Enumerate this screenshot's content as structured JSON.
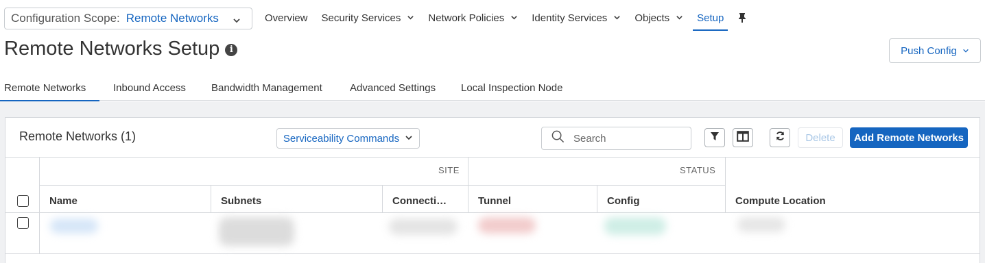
{
  "scope": {
    "label": "Configuration Scope:",
    "value": "Remote Networks"
  },
  "nav": {
    "items": [
      {
        "label": "Overview",
        "dropdown": false
      },
      {
        "label": "Security Services",
        "dropdown": true
      },
      {
        "label": "Network Policies",
        "dropdown": true
      },
      {
        "label": "Identity Services",
        "dropdown": true
      },
      {
        "label": "Objects",
        "dropdown": true
      },
      {
        "label": "Setup",
        "dropdown": false,
        "active": true
      }
    ],
    "pin_icon": "pin-icon"
  },
  "page": {
    "title": "Remote Networks Setup",
    "info_glyph": "i"
  },
  "push_config": {
    "label": "Push Config"
  },
  "tabs": [
    {
      "label": "Remote Networks",
      "active": true
    },
    {
      "label": "Inbound Access"
    },
    {
      "label": "Bandwidth Management"
    },
    {
      "label": "Advanced Settings"
    },
    {
      "label": "Local Inspection Node"
    }
  ],
  "panel": {
    "title": "Remote Networks (1)",
    "serviceability_label": "Serviceability Commands",
    "search_placeholder": "Search",
    "delete_label": "Delete",
    "add_label": "Add Remote Networks"
  },
  "table": {
    "groups": {
      "site": "SITE",
      "status": "STATUS"
    },
    "columns": [
      "Name",
      "Subnets",
      "Connecti…",
      "Tunnel",
      "Config",
      "Compute Location"
    ]
  },
  "colors": {
    "accent": "#1565c0",
    "page_bg": "#f0f1f3",
    "border": "#d5d8dc"
  }
}
